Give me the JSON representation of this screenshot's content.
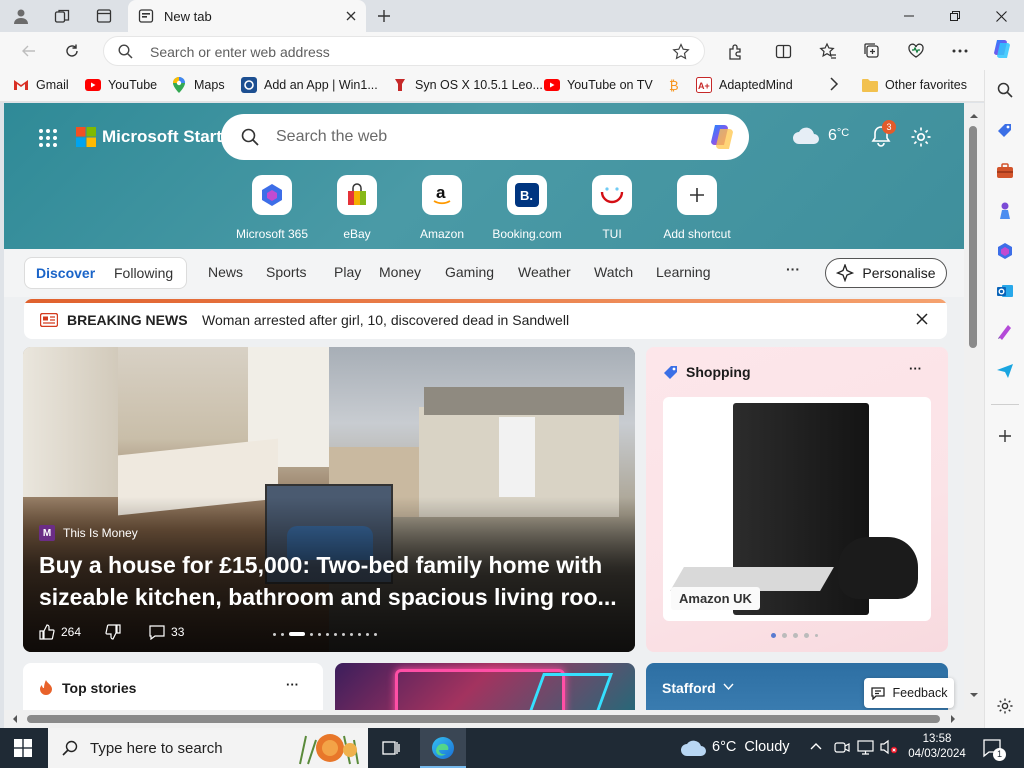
{
  "tab": {
    "title": "New tab"
  },
  "address": {
    "placeholder": "Search or enter web address"
  },
  "favorites": [
    {
      "label": "Gmail",
      "icon": "gmail-icon",
      "color": "#d93025"
    },
    {
      "label": "YouTube",
      "icon": "youtube-icon",
      "color": "#ff0000"
    },
    {
      "label": "Maps",
      "icon": "maps-icon",
      "color": "#34a853"
    },
    {
      "label": "Add an App | Win1...",
      "icon": "app-icon",
      "color": "#1d4f91"
    },
    {
      "label": "Syn OS X 10.5.1 Leo...",
      "icon": "syn-icon",
      "color": "#c62828"
    },
    {
      "label": "YouTube on TV",
      "icon": "youtube-icon",
      "color": "#ff0000"
    },
    {
      "label": "",
      "icon": "bitcoin-icon",
      "color": "#f7931a"
    },
    {
      "label": "AdaptedMind",
      "icon": "adaptedmind-icon",
      "color": "#c62828"
    },
    {
      "label": "Other favorites",
      "icon": "folder-icon",
      "color": "#f2c14e"
    }
  ],
  "brand": {
    "name": "Microsoft Start"
  },
  "search": {
    "placeholder": "Search the web"
  },
  "weather": {
    "temp": "6",
    "unit": "°C"
  },
  "notifications": {
    "count": "3"
  },
  "quicklinks": [
    {
      "label": "Microsoft 365",
      "icon": "microsoft365-icon"
    },
    {
      "label": "eBay",
      "icon": "ebay-icon"
    },
    {
      "label": "Amazon",
      "icon": "amazon-icon"
    },
    {
      "label": "Booking.com",
      "icon": "booking-icon"
    },
    {
      "label": "TUI",
      "icon": "tui-icon"
    },
    {
      "label": "Add shortcut",
      "icon": "plus-icon"
    }
  ],
  "nav": {
    "segments": [
      "Discover",
      "Following"
    ],
    "items": [
      "News",
      "Sports",
      "Play",
      "Money",
      "Gaming",
      "Weather",
      "Watch",
      "Learning"
    ],
    "more": "···",
    "personalise": "Personalise"
  },
  "breaking": {
    "label": "BREAKING NEWS",
    "text": "Woman arrested after girl, 10, discovered dead in Sandwell"
  },
  "mainstory": {
    "source": "This Is Money",
    "source_initial": "M",
    "headline": "Buy a house for £15,000: Two-bed family home with sizeable kitchen, bathroom and spacious living roo...",
    "likes": "264",
    "comments": "33"
  },
  "shopping": {
    "title": "Shopping",
    "more": "···",
    "product_store": "Amazon UK"
  },
  "topstories": {
    "title": "Top stories",
    "more": "···"
  },
  "stafford": {
    "title": "Stafford"
  },
  "feedback": {
    "label": "Feedback"
  },
  "taskbar": {
    "search_placeholder": "Type here to search",
    "weather": "6°C  Cloudy",
    "time": "13:58",
    "date": "04/03/2024",
    "notif_count": "1"
  }
}
